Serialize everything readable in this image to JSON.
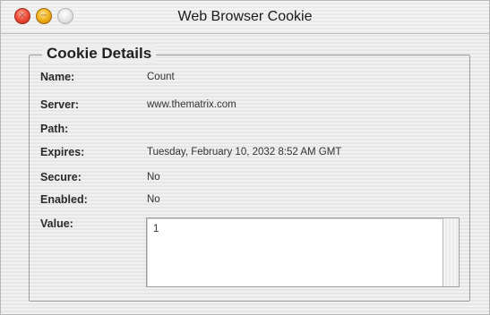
{
  "window": {
    "title": "Web Browser Cookie"
  },
  "group": {
    "legend": "Cookie Details"
  },
  "fields": [
    {
      "label": "Name:",
      "value": "Count"
    },
    {
      "label": "Server:",
      "value": "www.thematrix.com"
    },
    {
      "label": "Path:",
      "value": ""
    },
    {
      "label": "Expires:",
      "value": "Tuesday, February 10, 2032  8:52 AM GMT"
    },
    {
      "label": "Secure:",
      "value": "No"
    },
    {
      "label": "Enabled:",
      "value": "No"
    },
    {
      "label": "Value:",
      "value": "1"
    }
  ],
  "icons": {
    "close": "close-icon",
    "minimize": "minimize-icon",
    "zoom": "zoom-icon"
  },
  "colors": {
    "close": "#f2503b",
    "minimize": "#f5b51f",
    "zoom": "#e4e4e4",
    "window_bg": "#ececec"
  }
}
